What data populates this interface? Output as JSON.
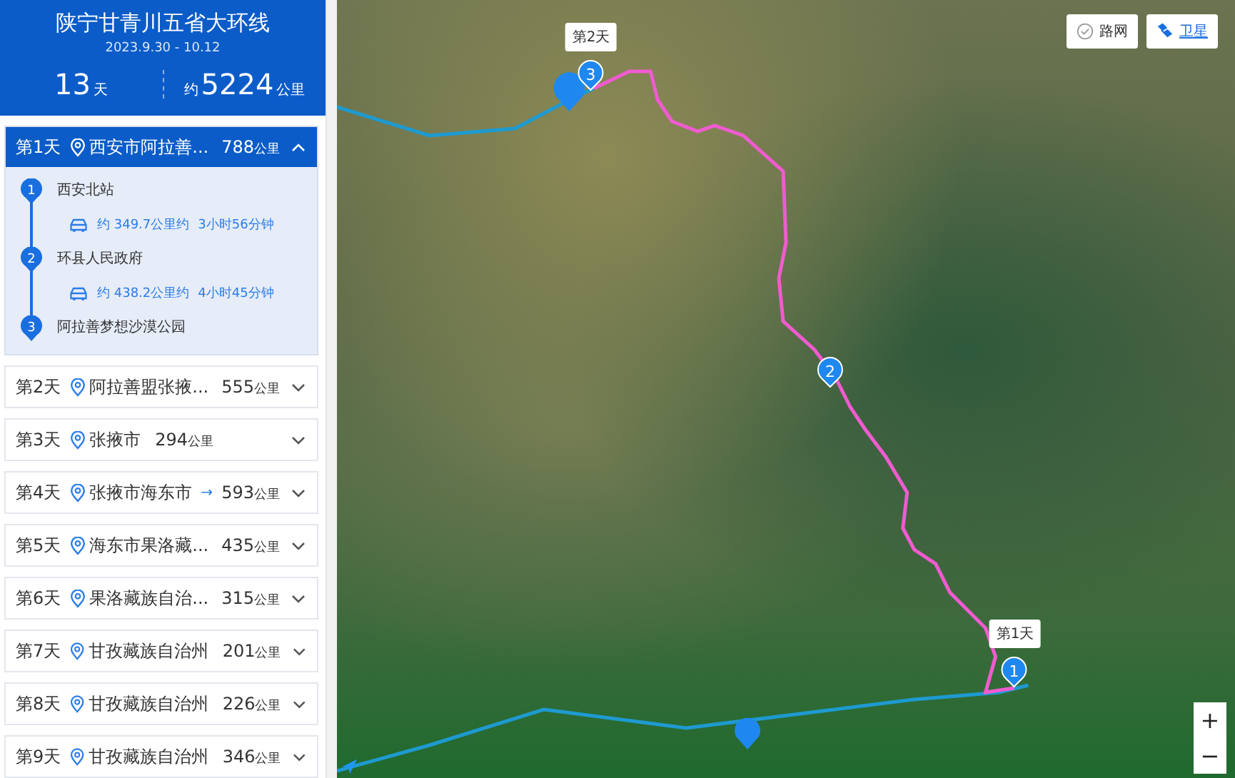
{
  "trip": {
    "title": "陕宁甘青川五省大环线",
    "dates": "2023.9.30 - 10.12",
    "days": "13",
    "days_unit": "天",
    "distance_prefix": "约",
    "distance": "5224",
    "distance_unit": "公里"
  },
  "days": [
    {
      "label": "第1天",
      "place": "西安市阿拉善...",
      "km": "788",
      "unit": "公里",
      "expanded": true,
      "stops": [
        {
          "number": "1",
          "name": "西安北站",
          "leg": {
            "distance": "约 349.7公里约",
            "time": "3小时56分钟"
          }
        },
        {
          "number": "2",
          "name": "环县人民政府",
          "leg": {
            "distance": "约 438.2公里约",
            "time": "4小时45分钟"
          }
        },
        {
          "number": "3",
          "name": "阿拉善梦想沙漠公园"
        }
      ]
    },
    {
      "label": "第2天",
      "place": "阿拉善盟张掖...",
      "km": "555",
      "unit": "公里",
      "expanded": false
    },
    {
      "label": "第3天",
      "place": "张掖市",
      "km": "294",
      "unit": "公里",
      "expanded": false
    },
    {
      "label": "第4天",
      "place": "张掖市海东市",
      "mark": "→",
      "km": "593",
      "unit": "公里",
      "expanded": false
    },
    {
      "label": "第5天",
      "place": "海东市果洛藏...",
      "km": "435",
      "unit": "公里",
      "expanded": false
    },
    {
      "label": "第6天",
      "place": "果洛藏族自治...",
      "km": "315",
      "unit": "公里",
      "expanded": false
    },
    {
      "label": "第7天",
      "place": "甘孜藏族自治州",
      "km": "201",
      "unit": "公里",
      "expanded": false
    },
    {
      "label": "第8天",
      "place": "甘孜藏族自治州",
      "km": "226",
      "unit": "公里",
      "expanded": false
    },
    {
      "label": "第9天",
      "place": "甘孜藏族自治州",
      "km": "346",
      "unit": "公里",
      "expanded": false
    }
  ],
  "map": {
    "layers": [
      {
        "label": "路网",
        "selected": false
      },
      {
        "label": "卫星",
        "selected": true
      }
    ],
    "day_labels": [
      "第2天",
      "第1天"
    ],
    "markers": [
      "1",
      "2",
      "3"
    ],
    "zoom": [
      "+",
      "−"
    ]
  }
}
